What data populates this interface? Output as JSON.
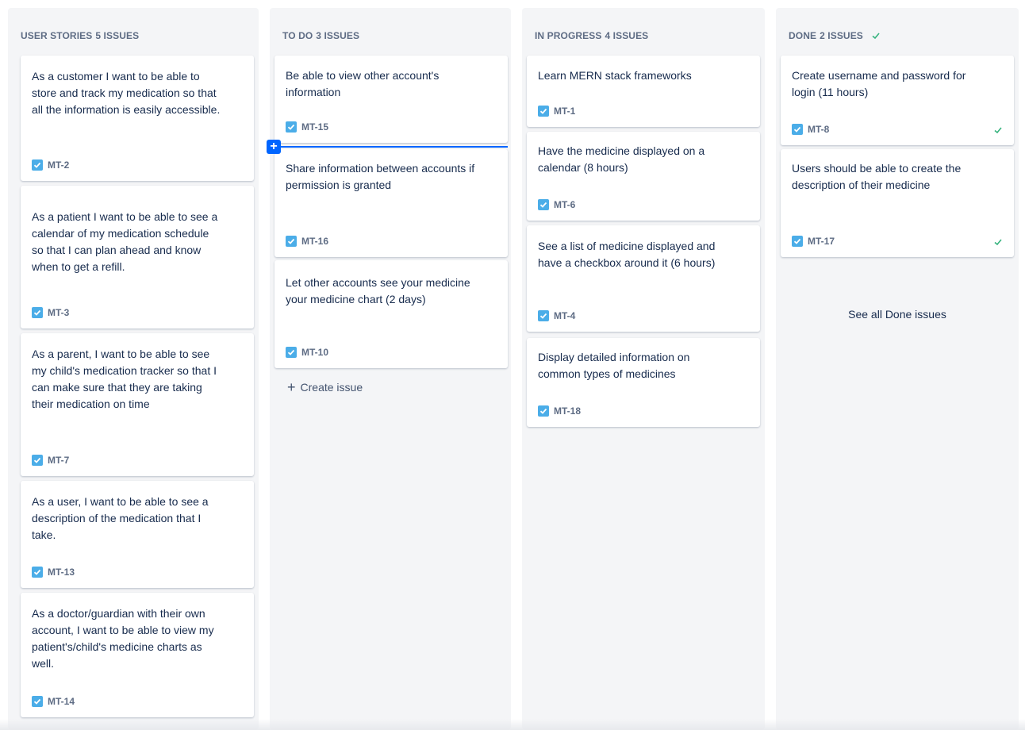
{
  "columns": [
    {
      "title": "USER STORIES",
      "count": "5 ISSUES",
      "cards": [
        {
          "summary": "As a customer I want to be able to store and track my medication so that all the information is easily accessible.",
          "key": "MT-2"
        },
        {
          "summary": "As a patient I want to be able to see a calendar of my medication schedule so that I can plan ahead and know when to get a refill.",
          "key": "MT-3"
        },
        {
          "summary": "As a parent, I want to be able to see my child's medication tracker so that I can make sure that they are taking their medication on time",
          "key": "MT-7"
        },
        {
          "summary": "As a user, I want to be able to see a description of the medication that I take.",
          "key": "MT-13"
        },
        {
          "summary": "As a doctor/guardian with their own account, I want to be able to view my patient's/child's medicine charts as well.",
          "key": "MT-14"
        }
      ]
    },
    {
      "title": "TO DO",
      "count": "3 ISSUES",
      "cards": [
        {
          "summary": "Be able to view other account's information",
          "key": "MT-15"
        },
        {
          "summary": "Share information between accounts if permission is granted",
          "key": "MT-16"
        },
        {
          "summary": "Let other accounts see your medicine your medicine chart (2 days)",
          "key": "MT-10"
        }
      ],
      "create_label": "Create issue"
    },
    {
      "title": "IN PROGRESS",
      "count": "4 ISSUES",
      "cards": [
        {
          "summary": "Learn MERN stack frameworks",
          "key": "MT-1"
        },
        {
          "summary": "Have the medicine displayed on a calendar (8 hours)",
          "key": "MT-6"
        },
        {
          "summary": "See a list of medicine displayed and have a checkbox around it (6 hours)",
          "key": "MT-4"
        },
        {
          "summary": "Display detailed information on common types of medicines",
          "key": "MT-18"
        }
      ]
    },
    {
      "title": "DONE",
      "count": "2 ISSUES",
      "cards": [
        {
          "summary": "Create username and password for login (11 hours)",
          "key": "MT-8"
        },
        {
          "summary": "Users should be able to create the description of their medicine",
          "key": "MT-17"
        }
      ],
      "see_all_label": "See all Done issues"
    }
  ],
  "colors": {
    "story_icon": "#4bade8",
    "done_check": "#36b37e",
    "drop_indicator": "#0065ff"
  }
}
